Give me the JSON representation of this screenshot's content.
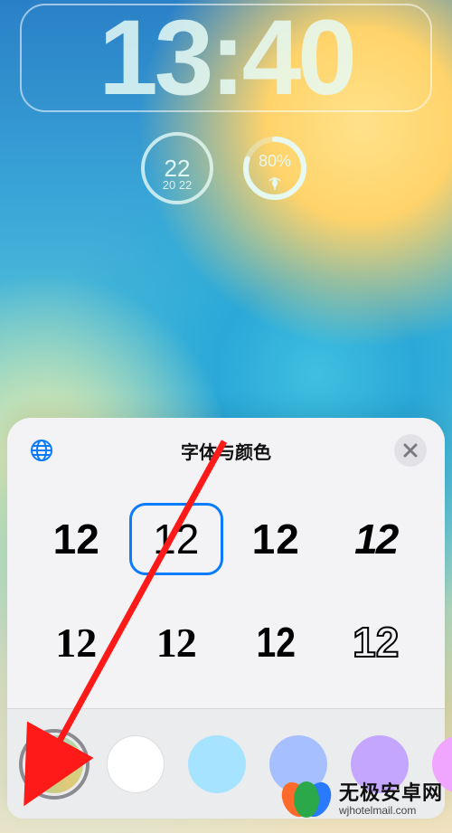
{
  "lockscreen": {
    "time": "13:40",
    "widgets": {
      "temperature": {
        "current": "22",
        "low": "20",
        "high": "22"
      },
      "precipitation": {
        "percent": "80%"
      }
    }
  },
  "sheet": {
    "title": "字体与颜色",
    "font_sample": "12",
    "fonts": [
      {
        "id": "f1",
        "selected": false
      },
      {
        "id": "f2",
        "selected": true
      },
      {
        "id": "f3",
        "selected": false
      },
      {
        "id": "f4",
        "selected": false
      },
      {
        "id": "f5",
        "selected": false
      },
      {
        "id": "f6",
        "selected": false
      },
      {
        "id": "f7",
        "selected": false
      },
      {
        "id": "f8",
        "selected": false
      }
    ],
    "colors": [
      {
        "id": "sw0",
        "name": "gradient",
        "selected": true
      },
      {
        "id": "sw1",
        "name": "white",
        "selected": false
      },
      {
        "id": "sw2",
        "name": "light-blue",
        "selected": false
      },
      {
        "id": "sw3",
        "name": "periwinkle",
        "selected": false
      },
      {
        "id": "sw4",
        "name": "lavender",
        "selected": false
      },
      {
        "id": "sw5",
        "name": "pink",
        "selected": false
      }
    ]
  },
  "watermark": {
    "cn": "无极安卓网",
    "en": "wjhotelmail.com"
  }
}
